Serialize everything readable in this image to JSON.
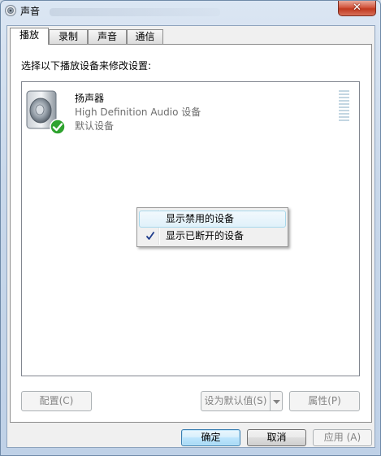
{
  "window": {
    "title": "声音",
    "close_label": "✕"
  },
  "tabs": [
    {
      "label": "播放",
      "active": true
    },
    {
      "label": "录制",
      "active": false
    },
    {
      "label": "声音",
      "active": false
    },
    {
      "label": "通信",
      "active": false
    }
  ],
  "playback": {
    "instruction": "选择以下播放设备来修改设置:",
    "devices": [
      {
        "name": "扬声器",
        "driver": "High Definition Audio 设备",
        "status": "默认设备",
        "icon": "speaker-icon",
        "badge_icon": "default-check-icon"
      }
    ]
  },
  "context_menu": {
    "items": [
      {
        "label": "显示禁用的设备",
        "checked": false,
        "highlighted": true
      },
      {
        "label": "显示已断开的设备",
        "checked": true,
        "highlighted": false
      }
    ]
  },
  "panel_buttons": {
    "configure": "配置(C)",
    "set_default": "设为默认值(S)",
    "properties": "属性(P)"
  },
  "dialog_buttons": {
    "ok": "确定",
    "cancel": "取消",
    "apply": "应用 (A)"
  },
  "colors": {
    "accent": "#3c7fb1",
    "check_green": "#2fa32f",
    "close_red": "#c0391f"
  }
}
